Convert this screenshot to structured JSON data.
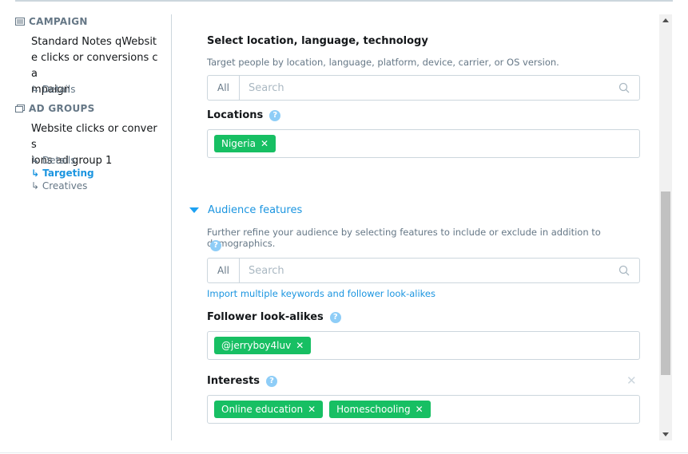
{
  "sidebar": {
    "campaign_heading": "CAMPAIGN",
    "campaign_name_lines": [
      "Standard Notes qWebsit",
      "e clicks or conversions ca",
      "mpaign"
    ],
    "campaign_details": "↳ Details",
    "adgroups_heading": "AD GROUPS",
    "adgroup_name_lines": [
      "Website clicks or convers",
      "ions ad group 1"
    ],
    "adgroup_links": [
      "↳ Details",
      "↳ Targeting",
      "↳ Creatives"
    ],
    "active_link": "Targeting"
  },
  "main": {
    "location_section": {
      "title": "Select location, language, technology",
      "description": "Target people by location, language, platform, device, carrier, or OS version.",
      "search_all": "All",
      "search_placeholder": "Search"
    },
    "locations": {
      "label": "Locations",
      "tags": [
        "Nigeria"
      ]
    },
    "audience": {
      "toggle_label": "Audience features",
      "description": "Further refine your audience by selecting features to include or exclude in addition to demographics.",
      "search_all": "All",
      "search_placeholder": "Search",
      "import_link": "Import multiple keywords and follower look-alikes"
    },
    "follower_lookalikes": {
      "label": "Follower look-alikes",
      "tags": [
        "@jerryboy4luv"
      ]
    },
    "interests": {
      "label": "Interests",
      "tags": [
        "Online education",
        "Homeschooling"
      ]
    }
  },
  "icons": {
    "help": "?",
    "remove": "✕",
    "clear": "✕"
  },
  "colors": {
    "accent": "#1b95e0",
    "tag_green": "#17bf63",
    "help_blue": "#8ecdf7",
    "muted": "#657786"
  }
}
